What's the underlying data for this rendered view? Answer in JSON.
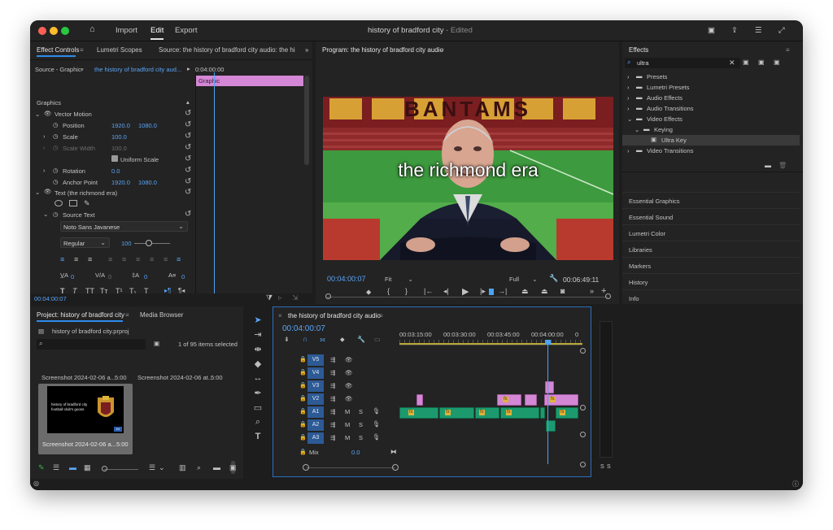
{
  "window": {
    "title": "history of bradford city",
    "title_suffix": "- Edited",
    "menu": [
      "Import",
      "Edit",
      "Export"
    ]
  },
  "effect_controls": {
    "tabs": [
      "Effect Controls",
      "Lumetri Scopes",
      "Source: the history of bradford city audio: the histo"
    ],
    "source_label": "Source - Graphic",
    "clip_label": "the history of bradford city aud...",
    "ruler_time": "0:04:00:00",
    "graphic_clip": "Graphic",
    "section_graphics": "Graphics",
    "vector_motion": "Vector Motion",
    "position_label": "Position",
    "position_x": "1920.0",
    "position_y": "1080.0",
    "scale_label": "Scale",
    "scale_value": "100.0",
    "scale_width_label": "Scale Width",
    "scale_width_value": "100.0",
    "uniform_scale": "Uniform Scale",
    "rotation_label": "Rotation",
    "rotation_value": "0.0",
    "anchor_label": "Anchor Point",
    "anchor_x": "1920.0",
    "anchor_y": "1080.0",
    "text_layer": "Text (the richmond era)",
    "source_text": "Source Text",
    "font_name": "Noto Sans Javanese",
    "font_style": "Regular",
    "font_size": "100",
    "tracking_vals": [
      "0",
      "0",
      "0",
      "0"
    ],
    "timecode": "00:04:00:07"
  },
  "program": {
    "title": "Program: the history of bradford city audio",
    "overlay_text": "the richmond era",
    "banner_text": "BANTAMS",
    "timecode": "00:04:00:07",
    "fit": "Fit",
    "quality": "Full",
    "duration": "00:06:49:11"
  },
  "effects": {
    "title": "Effects",
    "search_value": "ultra",
    "tree": [
      {
        "label": "Presets",
        "level": 0,
        "open": false
      },
      {
        "label": "Lumetri Presets",
        "level": 0,
        "open": false
      },
      {
        "label": "Audio Effects",
        "level": 0,
        "open": false
      },
      {
        "label": "Audio Transitions",
        "level": 0,
        "open": false
      },
      {
        "label": "Video Effects",
        "level": 0,
        "open": true
      },
      {
        "label": "Keying",
        "level": 1,
        "open": true
      },
      {
        "label": "Ultra Key",
        "level": 2,
        "open": false
      },
      {
        "label": "Video Transitions",
        "level": 0,
        "open": false
      }
    ],
    "sections": [
      "Essential Graphics",
      "Essential Sound",
      "Lumetri Color",
      "Libraries",
      "Markers",
      "History",
      "Info"
    ]
  },
  "project": {
    "tabs": [
      "Project: history of bradford city",
      "Media Browser"
    ],
    "file": "history of bradford city.prproj",
    "count": "1 of 95 items selected",
    "items": [
      "Screenshot 2024-02-06 a...",
      "Screenshot 2024-02-06 at...",
      "Screenshot 2024-02-06 a..."
    ],
    "item_durations": [
      "5:00",
      "5:00",
      "5:00"
    ],
    "thumb_text": "history of bradford city football club's gooss"
  },
  "timeline": {
    "title": "the history of bradford city audio",
    "timecode": "00:04:00:07",
    "ruler": [
      "00:03:15:00",
      "00:03:30:00",
      "00:03:45:00",
      "00:04:00:00",
      "0"
    ],
    "tracks": [
      "V5",
      "V4",
      "V3",
      "V2",
      "A1",
      "A2",
      "A3"
    ],
    "mix_label": "Mix",
    "mix_value": "0.0",
    "mute_solo": [
      "M",
      "S"
    ]
  },
  "meter": {
    "labels": [
      "S",
      "S"
    ]
  },
  "colors": {
    "accent": "#2d8ceb",
    "video_clip": "#d487d4",
    "audio_clip": "#1c9a6d",
    "playhead": "#4aa3f5"
  }
}
